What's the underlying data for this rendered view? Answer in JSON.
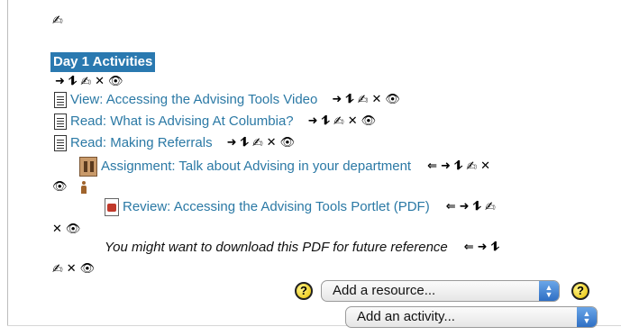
{
  "section": {
    "title": "Day 1 Activities"
  },
  "items": [
    {
      "type": "resource",
      "label": "View: Accessing the Advising Tools Video"
    },
    {
      "type": "resource",
      "label": "Read: What is Advising At Columbia?"
    },
    {
      "type": "resource",
      "label": "Read: Making Referrals"
    },
    {
      "type": "assignment",
      "label": "Assignment: Talk about Advising in your department"
    },
    {
      "type": "pdf",
      "label": "Review: Accessing the Advising Tools Portlet (PDF)"
    },
    {
      "type": "label",
      "label": "You might want to download this PDF for future reference"
    }
  ],
  "controls": {
    "add_resource": "Add a resource...",
    "add_activity": "Add an activity...",
    "help_glyph": "?"
  },
  "icons": {
    "edit": "✍",
    "move_right": "➜",
    "move_updown": "⥮",
    "delete": "✕",
    "visible": "👁",
    "move_left": "⇐"
  },
  "colors": {
    "link": "#2b79a5",
    "highlight": "#2a79b0",
    "select_arrow": "#3a7fd0",
    "help": "#f1d200"
  }
}
